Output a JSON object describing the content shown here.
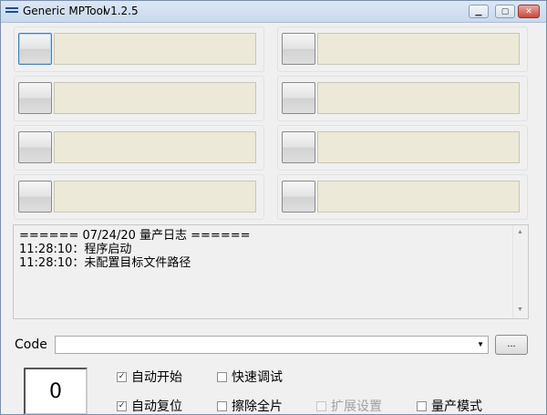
{
  "window": {
    "title": "Generic MPTool",
    "version": "v1.2.5",
    "minimize_glyph": "▁",
    "maximize_glyph": "▢",
    "close_glyph": "✕"
  },
  "log": {
    "lines": [
      "====== 07/24/20 量产日志 ======",
      "11:28:10：程序启动",
      "11:28:10：未配置目标文件路径"
    ],
    "scroll_up_glyph": "▲",
    "scroll_down_glyph": "▼"
  },
  "code": {
    "label": "Code",
    "value": "",
    "dropdown_glyph": "▼",
    "browse_label": "..."
  },
  "counter": {
    "value": "0"
  },
  "options": {
    "auto_start": {
      "label": "自动开始",
      "checked": true
    },
    "quick_debug": {
      "label": "快速调试",
      "checked": false
    },
    "auto_reset": {
      "label": "自动复位",
      "checked": true
    },
    "erase_all": {
      "label": "擦除全片",
      "checked": false
    },
    "ext_settings": {
      "label": "扩展设置",
      "checked": false,
      "enabled": false
    },
    "mp_mode": {
      "label": "量产模式",
      "checked": false
    }
  },
  "check_glyph": "✓"
}
